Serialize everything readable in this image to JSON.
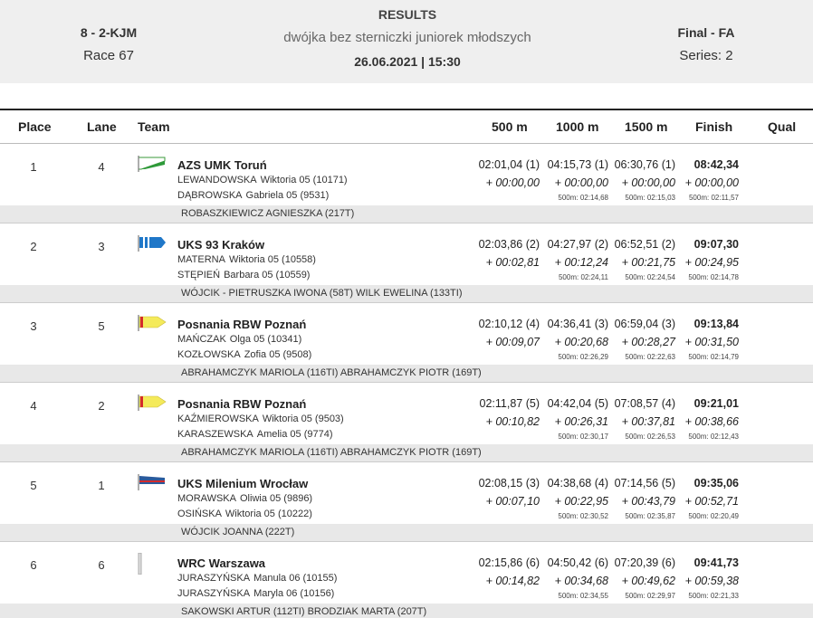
{
  "header": {
    "event_code": "8 - 2-KJM",
    "race": "Race 67",
    "title": "RESULTS",
    "subtitle": "dwójka bez sterniczki juniorek młodszych",
    "datetime": "26.06.2021 | 15:30",
    "phase": "Final - FA",
    "series": "Series: 2"
  },
  "columns": {
    "place": "Place",
    "lane": "Lane",
    "team": "Team",
    "m500": "500 m",
    "m1000": "1000 m",
    "m1500": "1500 m",
    "finish": "Finish",
    "qual": "Qual"
  },
  "rows": [
    {
      "place": "1",
      "lane": "4",
      "team": "AZS UMK Toruń",
      "flag_icon": "white-green-flag-icon",
      "rowers": [
        {
          "surname": "LEWANDOWSKA",
          "name": "Wiktoria 05 (10171)"
        },
        {
          "surname": "DĄBROWSKA",
          "name": "Gabriela 05 (9531)"
        }
      ],
      "coach": "ROBASZKIEWICZ AGNIESZKA (217T)",
      "t500": "02:01,04 (1)",
      "t1000": "04:15,73 (1)",
      "t1500": "06:30,76 (1)",
      "finish": "08:42,34",
      "d500": "+ 00:00,00",
      "d1000": "+ 00:00,00",
      "d1500": "+ 00:00,00",
      "dfin": "+ 00:00,00",
      "s1000": "500m: 02:14,68",
      "s1500": "500m: 02:15,03",
      "sfin": "500m: 02:11,57"
    },
    {
      "place": "2",
      "lane": "3",
      "team": "UKS 93 Kraków",
      "flag_icon": "blue-striped-flag-icon",
      "rowers": [
        {
          "surname": "MATERNA",
          "name": "Wiktoria 05 (10558)"
        },
        {
          "surname": "STĘPIEŃ",
          "name": "Barbara 05 (10559)"
        }
      ],
      "coach": "WÓJCIK - PIETRUSZKA IWONA (58T) WILK EWELINA (133TI)",
      "t500": "02:03,86 (2)",
      "t1000": "04:27,97 (2)",
      "t1500": "06:52,51 (2)",
      "finish": "09:07,30",
      "d500": "+ 00:02,81",
      "d1000": "+ 00:12,24",
      "d1500": "+ 00:21,75",
      "dfin": "+ 00:24,95",
      "s1000": "500m: 02:24,11",
      "s1500": "500m: 02:24,54",
      "sfin": "500m: 02:14,78"
    },
    {
      "place": "3",
      "lane": "5",
      "team": "Posnania RBW Poznań",
      "flag_icon": "yellow-red-flag-icon",
      "rowers": [
        {
          "surname": "MAŃCZAK",
          "name": "Olga 05 (10341)"
        },
        {
          "surname": "KOZŁOWSKA",
          "name": "Zofia 05 (9508)"
        }
      ],
      "coach": "ABRAHAMCZYK MARIOLA (116TI) ABRAHAMCZYK PIOTR (169T)",
      "t500": "02:10,12 (4)",
      "t1000": "04:36,41 (3)",
      "t1500": "06:59,04 (3)",
      "finish": "09:13,84",
      "d500": "+ 00:09,07",
      "d1000": "+ 00:20,68",
      "d1500": "+ 00:28,27",
      "dfin": "+ 00:31,50",
      "s1000": "500m: 02:26,29",
      "s1500": "500m: 02:22,63",
      "sfin": "500m: 02:14,79"
    },
    {
      "place": "4",
      "lane": "2",
      "team": "Posnania RBW Poznań",
      "flag_icon": "yellow-red-flag-icon",
      "rowers": [
        {
          "surname": "KAŹMIEROWSKA",
          "name": "Wiktoria 05 (9503)"
        },
        {
          "surname": "KARASZEWSKA",
          "name": "Amelia 05 (9774)"
        }
      ],
      "coach": "ABRAHAMCZYK MARIOLA (116TI) ABRAHAMCZYK PIOTR (169T)",
      "t500": "02:11,87 (5)",
      "t1000": "04:42,04 (5)",
      "t1500": "07:08,57 (4)",
      "finish": "09:21,01",
      "d500": "+ 00:10,82",
      "d1000": "+ 00:26,31",
      "d1500": "+ 00:37,81",
      "dfin": "+ 00:38,66",
      "s1000": "500m: 02:30,17",
      "s1500": "500m: 02:26,53",
      "sfin": "500m: 02:12,43"
    },
    {
      "place": "5",
      "lane": "1",
      "team": "UKS Milenium Wrocław",
      "flag_icon": "blue-red-flag-icon",
      "rowers": [
        {
          "surname": "MORAWSKA",
          "name": "Oliwia 05 (9896)"
        },
        {
          "surname": "OSIŃSKA",
          "name": "Wiktoria 05 (10222)"
        }
      ],
      "coach": "WÓJCIK JOANNA (222T)",
      "t500": "02:08,15 (3)",
      "t1000": "04:38,68 (4)",
      "t1500": "07:14,56 (5)",
      "finish": "09:35,06",
      "d500": "+ 00:07,10",
      "d1000": "+ 00:22,95",
      "d1500": "+ 00:43,79",
      "dfin": "+ 00:52,71",
      "s1000": "500m: 02:30,52",
      "s1500": "500m: 02:35,87",
      "sfin": "500m: 02:20,49"
    },
    {
      "place": "6",
      "lane": "6",
      "team": "WRC Warszawa",
      "flag_icon": "grey-bar-flag-icon",
      "rowers": [
        {
          "surname": "JURASZYŃSKA",
          "name": "Manula 06 (10155)"
        },
        {
          "surname": "JURASZYŃSKA",
          "name": "Maryla 06 (10156)"
        }
      ],
      "coach": "SAKOWSKI ARTUR (112TI) BRODZIAK MARTA (207T)",
      "t500": "02:15,86 (6)",
      "t1000": "04:50,42 (6)",
      "t1500": "07:20,39 (6)",
      "finish": "09:41,73",
      "d500": "+ 00:14,82",
      "d1000": "+ 00:34,68",
      "d1500": "+ 00:49,62",
      "dfin": "+ 00:59,38",
      "s1000": "500m: 02:34,55",
      "s1500": "500m: 02:29,97",
      "sfin": "500m: 02:21,33"
    }
  ]
}
